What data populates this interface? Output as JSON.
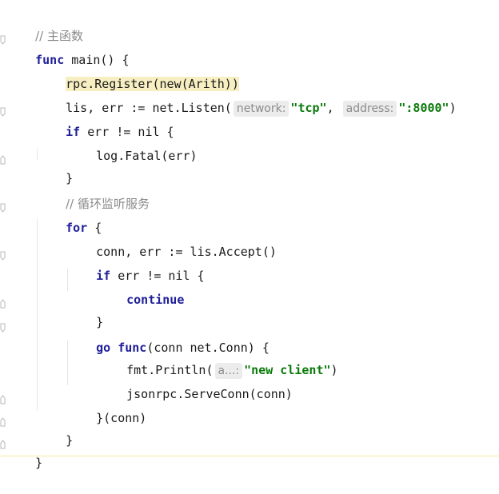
{
  "code": {
    "comment_main": "// 主函数",
    "kw_func": "func",
    "main_sig": " main() {",
    "register": "rpc.Register(new(Arith))",
    "listen_prefix": "lis, err := net.Listen(",
    "hint_network": "network:",
    "str_tcp": "\"tcp\"",
    "comma": ",",
    "hint_address": "address:",
    "str_port": "\":8000\"",
    "close_paren": ")",
    "kw_if": "if",
    "err_check": " err != nil {",
    "fatal": "log.Fatal(err)",
    "rbrace": "}",
    "comment_loop": "// 循环监听服务",
    "kw_for": "for",
    "for_rest": " {",
    "accept": "conn, err := lis.Accept()",
    "kw_continue": "continue",
    "kw_go": "go",
    "go_sig": "(conn net.Conn) {",
    "println": "fmt.Println(",
    "hint_a": "a...:",
    "str_client": "\"new client\"",
    "serve": "jsonrpc.ServeConn(conn)",
    "close_call": "}(conn)"
  },
  "colors": {
    "keyword": "#1f1f9a",
    "string": "#0b7a0b",
    "comment": "#8a8a8a",
    "highlight": "#f7efc2",
    "hint_bg": "#ececec"
  }
}
